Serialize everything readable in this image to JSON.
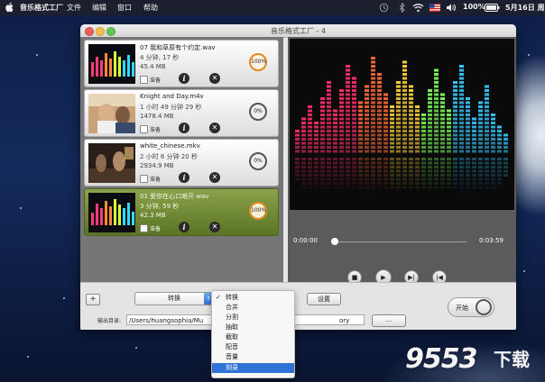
{
  "menubar": {
    "app_name": "音乐格式工厂",
    "menus": [
      "文件",
      "编辑",
      "窗口",
      "帮助"
    ],
    "battery": "100%",
    "date": "5月16日 周"
  },
  "window": {
    "title": "音乐格式工厂 - 4"
  },
  "files": [
    {
      "name": "07 我和草原有个约定.wav",
      "duration": "4 分钟, 17 秒",
      "size": "45.4 MB",
      "progress": "100%",
      "ready_label": "准备",
      "selected": false
    },
    {
      "name": "Knight and Day.m4v",
      "duration": "1 小时 49 分钟 29 秒",
      "size": "1478.4 MB",
      "progress": "0%",
      "ready_label": "准备",
      "selected": false
    },
    {
      "name": "white_chinese.mkv",
      "duration": "2 小时 6 分钟 20 秒",
      "size": "2934.9 MB",
      "progress": "0%",
      "ready_label": "准备",
      "selected": false
    },
    {
      "name": "01 爱你在心口难开.wav",
      "duration": "3 分钟, 59 秒",
      "size": "42.3 MB",
      "progress": "100%",
      "ready_label": "准备",
      "selected": true
    }
  ],
  "player": {
    "current_time": "0:00:00",
    "total_time": "0:03:59",
    "progress": 0.0
  },
  "controls": {
    "add_label": "+",
    "mode_value": "转换",
    "settings_label": "设置",
    "output_label": "输出目录:",
    "output_path": "/Users/huangsophia/Mu",
    "output_path_tail": "ory",
    "browse_label": "...",
    "start_label": "开始"
  },
  "mode_menu": {
    "items": [
      "转换",
      "合并",
      "分割",
      "抽取",
      "截取",
      "配音",
      "音量",
      "刻录"
    ],
    "checked_index": 0,
    "highlighted_index": 7
  },
  "watermark": {
    "number": "9553",
    "text": "下载"
  },
  "colors": {
    "selected_item": "#6f8a32",
    "progress_done": "#e38a20",
    "menu_highlight": "#2f73d6"
  }
}
